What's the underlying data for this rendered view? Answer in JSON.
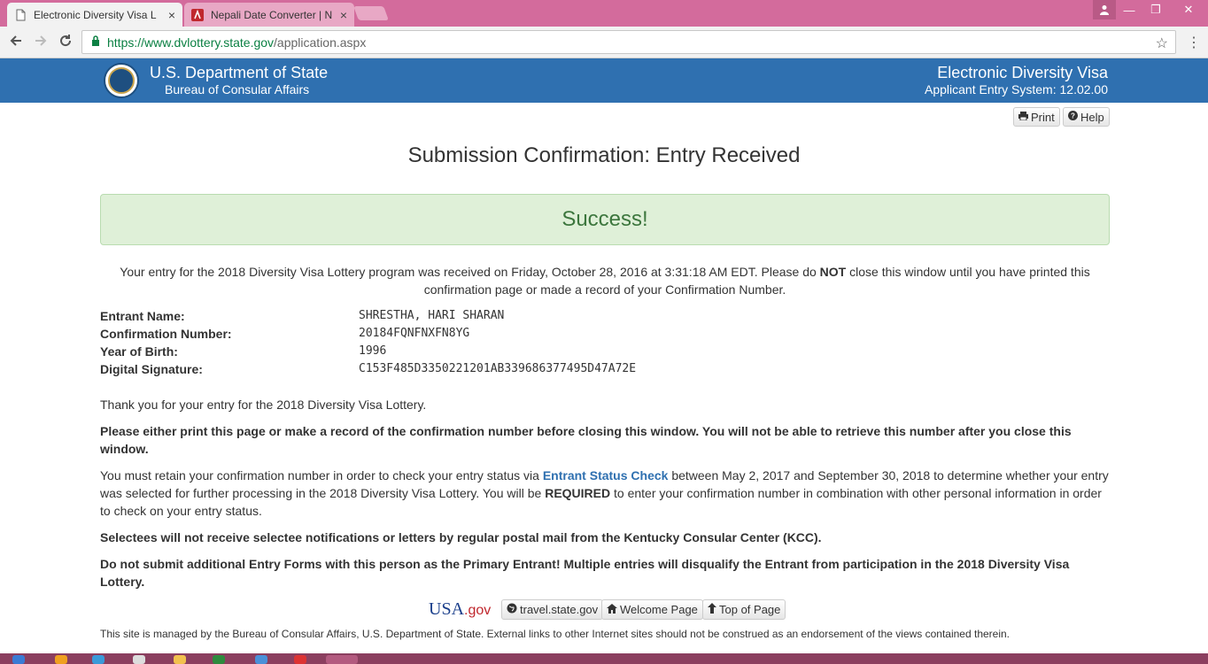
{
  "browser": {
    "tabs": [
      {
        "title": "Electronic Diversity Visa L",
        "close": "×"
      },
      {
        "title": "Nepali Date Converter | N",
        "close": "×"
      }
    ],
    "url_host": "https://www.dvlottery.state.gov",
    "url_path": "/application.aspx",
    "window_controls": {
      "minimize": "—",
      "maximize": "❐",
      "close": "✕"
    }
  },
  "header": {
    "dept_title": "U.S. Department of State",
    "dept_subtitle": "Bureau of Consular Affairs",
    "system_title": "Electronic Diversity Visa",
    "system_subtitle": "Applicant Entry System: 12.02.00"
  },
  "toolbar": {
    "print_label": "Print",
    "help_label": "Help"
  },
  "page": {
    "heading": "Submission Confirmation: Entry Received",
    "success_text": "Success!",
    "intro_before": "Your entry for the 2018 Diversity Visa Lottery program was received on Friday, October 28, 2016 at 3:31:18 AM EDT. Please do ",
    "intro_not": "NOT",
    "intro_after": " close this window until you have printed this confirmation page or made a record of your Confirmation Number."
  },
  "entry": {
    "fields": [
      {
        "label": "Entrant Name:",
        "value": "SHRESTHA, HARI SHARAN"
      },
      {
        "label": "Confirmation Number:",
        "value": "20184FQNFNXFN8YG"
      },
      {
        "label": "Year of Birth:",
        "value": "1996"
      },
      {
        "label": "Digital Signature:",
        "value": "C153F485D3350221201AB339686377495D47A72E"
      }
    ]
  },
  "messages": {
    "thanks": "Thank you for your entry for the 2018 Diversity Visa Lottery.",
    "print_warning": "Please either print this page or make a record of the confirmation number before closing this window. You will not be able to retrieve this number after you close this window.",
    "retain_before": "You must retain your confirmation number in order to check your entry status via ",
    "retain_link": "Entrant Status Check",
    "retain_middle": " between May 2, 2017 and September 30, 2018 to determine whether your entry was selected for further processing in the 2018 Diversity Visa Lottery. You will be ",
    "retain_required": "REQUIRED",
    "retain_after": " to enter your confirmation number in combination with other personal information in order to check on your entry status.",
    "selectees": "Selectees will not receive selectee notifications or letters by regular postal mail from the Kentucky Consular Center (KCC).",
    "no_additional": "Do not submit additional Entry Forms with this person as the Primary Entrant! Multiple entries will disqualify the Entrant from participation in the 2018 Diversity Visa Lottery."
  },
  "footer": {
    "usa_logo": "USA",
    "usa_logo_gov": ".gov",
    "travel_label": "travel.state.gov",
    "welcome_label": "Welcome Page",
    "top_label": "Top of Page",
    "disclaimer": "This site is managed by the Bureau of Consular Affairs, U.S. Department of State. External links to other Internet sites should not be construed as an endorsement of the views contained therein."
  }
}
